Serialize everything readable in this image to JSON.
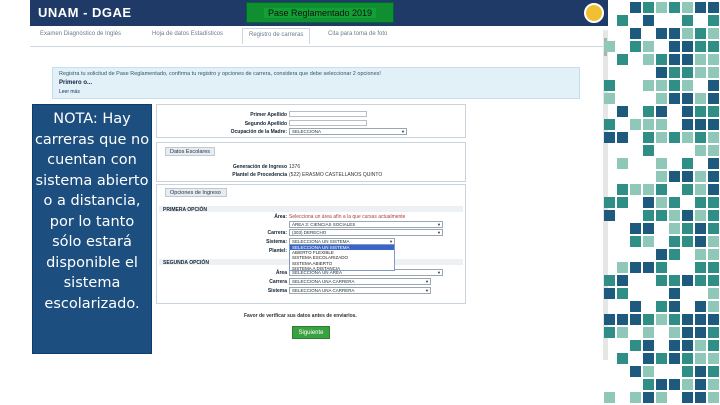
{
  "header": {
    "app_title": "UNAM - DGAE",
    "badge": "Pase Reglamentado 2019"
  },
  "tabs": [
    {
      "label": "Examen Diagnóstico de Inglés",
      "active": false
    },
    {
      "label": "Hoja de datos Estadísticos",
      "active": false
    },
    {
      "label": "Registro de carreras",
      "active": true
    },
    {
      "label": "Cita para toma de foto",
      "active": false
    }
  ],
  "info": {
    "text": "Registra tu solicitud de Pase Reglamentado, confirma tu registro y opciones de carrera, considera que debe seleccionar 2 opciones!",
    "first": "Primero o...",
    "link": "Leer más"
  },
  "note": {
    "lines": [
      "NOTA: Hay",
      "carreras que no",
      "cuentan con",
      "sistema abierto",
      "o a distancia,",
      "por lo tanto",
      "sólo estará",
      "disponible el",
      "sistema",
      "escolarizado."
    ]
  },
  "form": {
    "personal": {
      "primer_apellido_label": "Primer Apellido",
      "segundo_apellido_label": "Segundo Apellido",
      "ocupacion_label": "Ocupación de la Madre:",
      "ocupacion_value": "SELECCIONA"
    },
    "datos_escolares": {
      "header": "Datos Escolares",
      "generacion_label": "Generación de Ingreso",
      "generacion_value": "1376",
      "plantel_label": "Plantel de Procedencia",
      "plantel_value": "(522) ERASMO CASTELLANOS QUINTO"
    },
    "opciones": {
      "header": "Opciones de Ingreso",
      "primera": {
        "title": "PRIMERA OPCIÓN",
        "area_label": "Área:",
        "area_hint": "Selecciona un área afín a la que cursas actualmente",
        "area_value": "ÁREA 3: CIENCIAS SOCIALES",
        "carrera_label": "Carrera:",
        "carrera_value": "(303) DERECHO",
        "sistema_label": "Sistema:",
        "sistema_value": "SELECCIONA UN SISTEMA",
        "plantel_label": "Plantel:"
      },
      "dropdown_options": [
        "SELECCIONA UN SISTEMA",
        "SELECCIONA UN SISTEMA",
        "ABIERTO FLEXIBLE",
        "SISTEMA ESCOLARIZADO",
        "SISTEMA ABIERTO",
        "SISTEMA A DISTANCIA"
      ],
      "segunda": {
        "title": "SEGUNDA OPCIÓN",
        "area_label": "Área",
        "area_value": "SELECCIONA UN ÁREA",
        "carrera_label": "Carrera",
        "carrera_value": "SELECCIONA UNA CARRERA",
        "sistema_label": "Sistema",
        "sistema_value": "SELECCIONA UNA CARRERA"
      }
    },
    "confirm_text": "Favor de verificar sus datos antes de enviarlos.",
    "submit_label": "Siguiente"
  },
  "colors": {
    "header_bg": "#1f3a66",
    "note_bg": "#1c4f80",
    "badge_bg": "#0f8f2f",
    "button_bg": "#3aa141",
    "mosaic_dark": "#1d5a7e",
    "mosaic_teal": "#2f8f86",
    "mosaic_light": "#8fc7b8"
  }
}
